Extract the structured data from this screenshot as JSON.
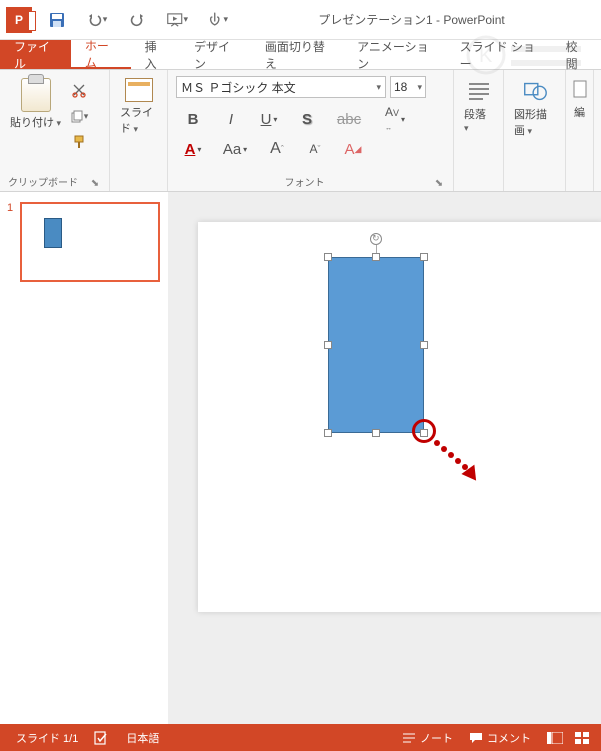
{
  "title": "プレゼンテーション1 - PowerPoint",
  "qat": {
    "save": "save",
    "undo": "undo",
    "redo": "redo",
    "start_from_beginning": "start-from-beginning",
    "touch_mouse": "touch-mouse-mode"
  },
  "tabs": {
    "file": "ファイル",
    "home": "ホーム",
    "insert": "挿入",
    "design": "デザイン",
    "transitions": "画面切り替え",
    "animations": "アニメーション",
    "slideshow": "スライド ショー",
    "review": "校閲"
  },
  "ribbon": {
    "clipboard": {
      "title": "クリップボード",
      "paste": "貼り付け"
    },
    "slides": {
      "label": "スライド"
    },
    "font": {
      "title": "フォント",
      "name": "ＭＳ Ｐゴシック 本文",
      "size": "18",
      "bold": "B",
      "italic": "I",
      "underline": "U",
      "shadow": "S",
      "strike": "abc",
      "spacing": "AV",
      "color": "A",
      "case": "Aa",
      "grow": "A",
      "shrink": "A",
      "clear": "A"
    },
    "paragraph": {
      "label": "段落"
    },
    "drawing": {
      "label": "図形描画"
    },
    "editing": {
      "partial": "編"
    }
  },
  "thumbnail": {
    "number": "1"
  },
  "status": {
    "slide": "スライド 1/1",
    "lang": "日本語",
    "notes": "ノート",
    "comments": "コメント"
  }
}
